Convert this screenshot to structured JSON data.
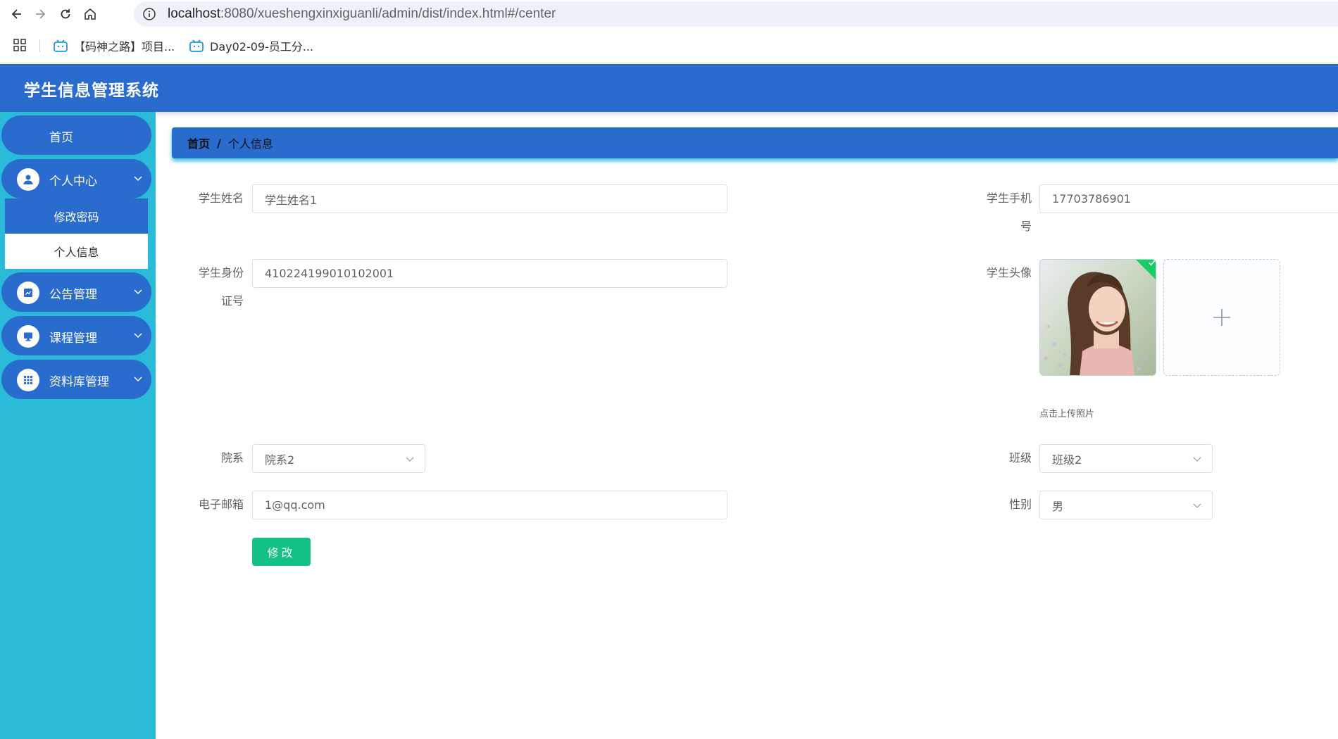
{
  "browser": {
    "url_host": "localhost",
    "url_path": ":8080/xueshengxinxiguanli/admin/dist/index.html#/center",
    "bookmarks": [
      {
        "label": "【码神之路】项目...",
        "icon": "bilibili-icon"
      },
      {
        "label": "Day02-09-员工分...",
        "icon": "bilibili-icon"
      }
    ]
  },
  "header": {
    "title": "学生信息管理系统"
  },
  "sidebar": {
    "home": "首页",
    "items": [
      {
        "label": "个人中心",
        "icon": "user-icon"
      },
      {
        "label": "公告管理",
        "icon": "chart-icon"
      },
      {
        "label": "课程管理",
        "icon": "monitor-icon"
      },
      {
        "label": "资料库管理",
        "icon": "grid-icon"
      }
    ],
    "submenu": [
      {
        "label": "修改密码",
        "active": true
      },
      {
        "label": "个人信息",
        "active": false
      }
    ]
  },
  "breadcrumb": {
    "home": "首页",
    "separator": "/",
    "current": "个人信息"
  },
  "form": {
    "name_label": "学生姓名",
    "name_value": "学生姓名1",
    "phone_label_line1": "学生手机",
    "phone_label_line2": "号",
    "phone_value": "17703786901",
    "id_label_line1": "学生身份",
    "id_label_line2": "证号",
    "id_value": "410224199010102001",
    "avatar_label": "学生头像",
    "upload_tip": "点击上传照片",
    "department_label": "院系",
    "department_value": "院系2",
    "class_label": "班级",
    "class_value": "班级2",
    "email_label": "电子邮箱",
    "email_value": "1@qq.com",
    "gender_label": "性别",
    "gender_value": "男",
    "submit_label": "修改"
  },
  "colors": {
    "header": "#2a6bce",
    "sidebar": "#29bbd8",
    "submit": "#13c086",
    "upload_success": "#13ce66"
  }
}
